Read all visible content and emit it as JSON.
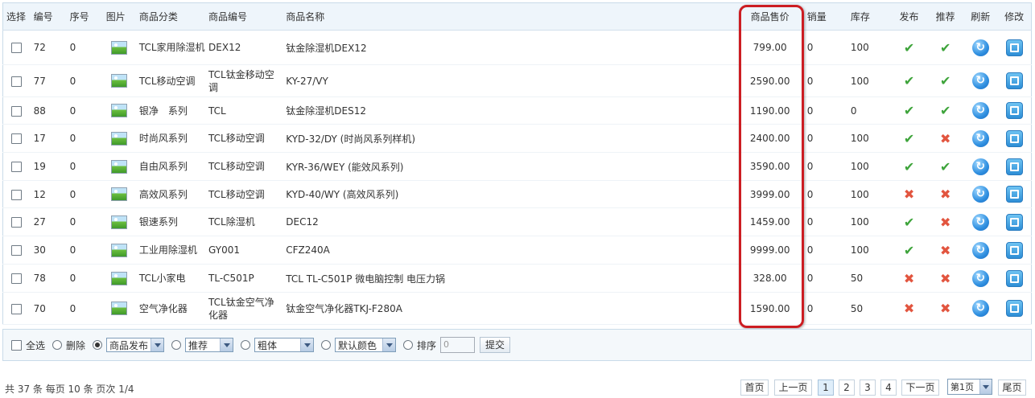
{
  "columns": {
    "select": "选择",
    "id": "编号",
    "order": "序号",
    "image": "图片",
    "category": "商品分类",
    "code": "商品编号",
    "name": "商品名称",
    "price": "商品售价",
    "sales": "销量",
    "stock": "库存",
    "publish": "发布",
    "recommend": "推荐",
    "refresh": "刷新",
    "edit": "修改"
  },
  "rows": [
    {
      "id": "72",
      "order": "0",
      "category": "TCL家用除湿机",
      "code": "DEX12",
      "name": "钛金除湿机DEX12",
      "price": "799.00",
      "sales": "0",
      "stock": "100",
      "published": true,
      "recommended": true
    },
    {
      "id": "77",
      "order": "0",
      "category": "TCL移动空调",
      "code": "TCL钛金移动空调",
      "name": "KY-27/VY",
      "price": "2590.00",
      "sales": "0",
      "stock": "100",
      "published": true,
      "recommended": true
    },
    {
      "id": "88",
      "order": "0",
      "category": "银净　系列",
      "code": "TCL",
      "name": "钛金除湿机DES12",
      "price": "1190.00",
      "sales": "0",
      "stock": "0",
      "published": true,
      "recommended": true
    },
    {
      "id": "17",
      "order": "0",
      "category": "时尚风系列",
      "code": "TCL移动空调",
      "name": "KYD-32/DY (时尚风系列样机)",
      "price": "2400.00",
      "sales": "0",
      "stock": "100",
      "published": true,
      "recommended": false
    },
    {
      "id": "19",
      "order": "0",
      "category": "自由风系列",
      "code": "TCL移动空调",
      "name": "KYR-36/WEY (能效风系列)",
      "price": "3590.00",
      "sales": "0",
      "stock": "100",
      "published": true,
      "recommended": true
    },
    {
      "id": "12",
      "order": "0",
      "category": "高效风系列",
      "code": "TCL移动空调",
      "name": "KYD-40/WY (高效风系列)",
      "price": "3999.00",
      "sales": "0",
      "stock": "100",
      "published": false,
      "recommended": false
    },
    {
      "id": "27",
      "order": "0",
      "category": "银速系列",
      "code": "TCL除湿机",
      "name": "DEC12",
      "price": "1459.00",
      "sales": "0",
      "stock": "100",
      "published": true,
      "recommended": false
    },
    {
      "id": "30",
      "order": "0",
      "category": "工业用除湿机",
      "code": "GY001",
      "name": "CFZ240A",
      "price": "9999.00",
      "sales": "0",
      "stock": "100",
      "published": true,
      "recommended": false
    },
    {
      "id": "78",
      "order": "0",
      "category": "TCL小家电",
      "code": "TL-C501P",
      "name": "TCL TL-C501P 微电脑控制 电压力锅",
      "price": "328.00",
      "sales": "0",
      "stock": "50",
      "published": false,
      "recommended": false
    },
    {
      "id": "70",
      "order": "0",
      "category": "空气净化器",
      "code": "TCL钛金空气净化器",
      "name": "钛金空气净化器TKJ-F280A",
      "price": "1590.00",
      "sales": "0",
      "stock": "50",
      "published": false,
      "recommended": false
    }
  ],
  "icons": {
    "publish_yes": "check-icon",
    "publish_no": "cross-icon",
    "refresh": "refresh-icon",
    "edit": "edit-icon",
    "image": "image-icon"
  },
  "colors": {
    "check": "#3ea43b",
    "cross": "#e2553f",
    "highlight": "#cc1d22",
    "header_bg": "#eef5fb"
  },
  "opbar": {
    "select_all": "全选",
    "delete": "删除",
    "publish_select": "商品发布",
    "recommend_select": "推荐",
    "bold_select": "粗体",
    "color_select": "默认颜色",
    "sort": "排序",
    "sort_placeholder": "0",
    "submit": "提交"
  },
  "pager": {
    "summary": "共 37 条 每页 10 条 页次 1/4",
    "first": "首页",
    "prev": "上一页",
    "pages": [
      "1",
      "2",
      "3",
      "4"
    ],
    "next": "下一页",
    "jump": "第1页",
    "last": "尾页"
  }
}
